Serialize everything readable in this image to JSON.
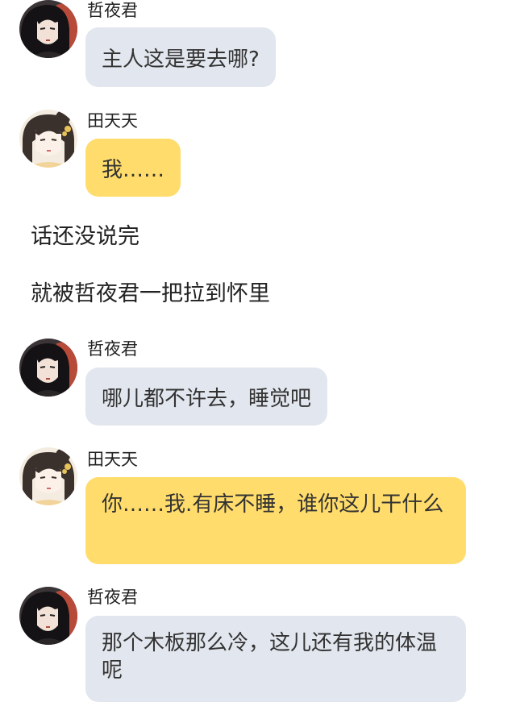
{
  "colors": {
    "bubble_gray": "#e2e6ee",
    "bubble_yellow": "#ffdc6b",
    "text": "#333333"
  },
  "messages": [
    {
      "sender": "哲夜君",
      "text": "主人这是要去哪?",
      "bubble": "gray",
      "avatar": "avatar-zheyejun"
    },
    {
      "sender": "田天天",
      "text": "我……",
      "bubble": "yellow",
      "avatar": "avatar-tiantiantian"
    },
    {
      "sender": "哲夜君",
      "text": "哪儿都不许去，睡觉吧",
      "bubble": "gray",
      "avatar": "avatar-zheyejun"
    },
    {
      "sender": "田天天",
      "text": "你……我.有床不睡，谁你这儿干什么",
      "bubble": "yellow",
      "avatar": "avatar-tiantiantian"
    },
    {
      "sender": "哲夜君",
      "text": "那个木板那么冷，这儿还有我的体温呢",
      "bubble": "gray",
      "avatar": "avatar-zheyejun"
    }
  ],
  "narration": [
    "话还没说完",
    "就被哲夜君一把拉到怀里"
  ]
}
